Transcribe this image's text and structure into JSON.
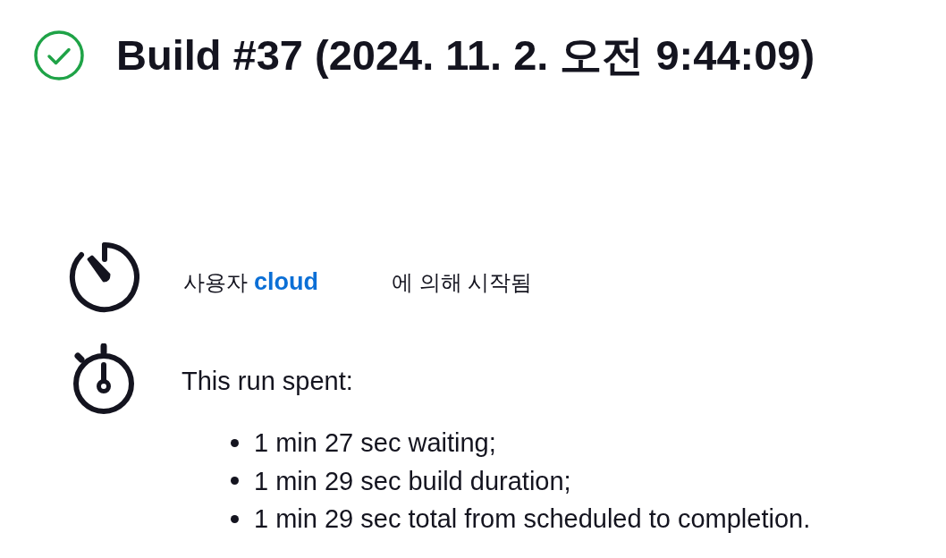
{
  "header": {
    "succeeded": true,
    "title": "Build #37 (2024. 11. 2. 오전 9:44:09)"
  },
  "cause": {
    "prefix": "사용자",
    "user": "cloud",
    "suffix": "에 의해 시작됨"
  },
  "timing": {
    "label": "This run spent:",
    "items": [
      "1 min 27 sec waiting;",
      "1 min 29 sec build duration;",
      "1 min 29 sec total from scheduled to completion."
    ]
  }
}
